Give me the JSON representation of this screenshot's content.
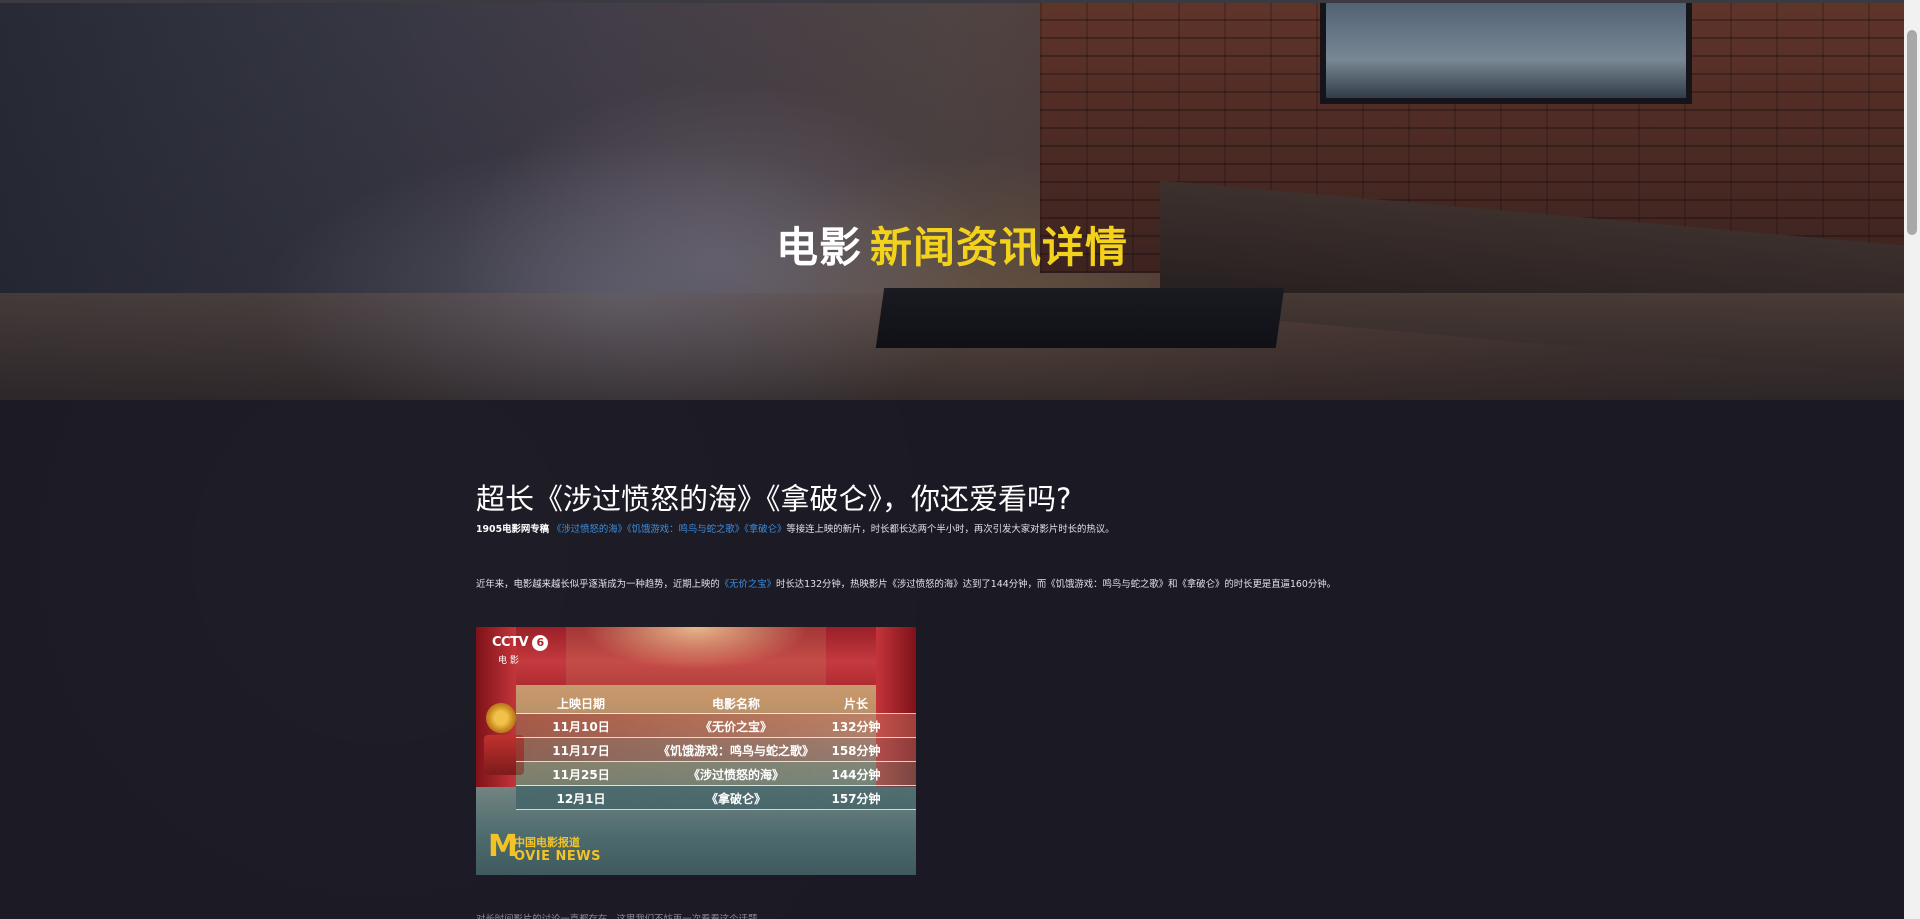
{
  "hero": {
    "title_white": "电影",
    "title_yellow": "新闻资讯详情"
  },
  "article": {
    "title": "超长《涉过愤怒的海》《拿破仑》，你还爱看吗?",
    "lead": {
      "source": "1905电影网专稿",
      "links": [
        "《涉过愤怒的海》",
        "《饥饿游戏：鸣鸟与蛇之歌》",
        "《拿破仑》"
      ],
      "rest": "等接连上映的新片，时长都长达两个半小时，再次引发大家对影片时长的热议。"
    },
    "para": {
      "before": "近年来，电影越来越长似乎逐渐成为一种趋势，近期上映的",
      "link": "《无价之宝》",
      "after": "时长达132分钟，热映影片《涉过愤怒的海》达到了144分钟，而《饥饿游戏：鸣鸟与蛇之歌》和《拿破仑》的时长更是直逼160分钟。"
    },
    "next_para_partial": "对长时间影片的讨论一直都存在，这里我们不妨再一次看看这个话题"
  },
  "schedule_image": {
    "channel": "CCTV",
    "channel_num": "6",
    "channel_sub": "电 影",
    "headers": [
      "上映日期",
      "电影名称",
      "片长"
    ],
    "rows": [
      [
        "11月10日",
        "《无价之宝》",
        "132分钟"
      ],
      [
        "11月17日",
        "《饥饿游戏：鸣鸟与蛇之歌》",
        "158分钟"
      ],
      [
        "11月25日",
        "《涉过愤怒的海》",
        "144分钟"
      ],
      [
        "12月1日",
        "《拿破仑》",
        "157分钟"
      ]
    ],
    "logo_m": "M",
    "logo_cn": "中国电影报道",
    "logo_en": "OVIE NEWS"
  },
  "colors": {
    "accent_yellow": "#f3d21c",
    "link_blue": "#3b8fe0",
    "page_bg": "#1b1923"
  }
}
